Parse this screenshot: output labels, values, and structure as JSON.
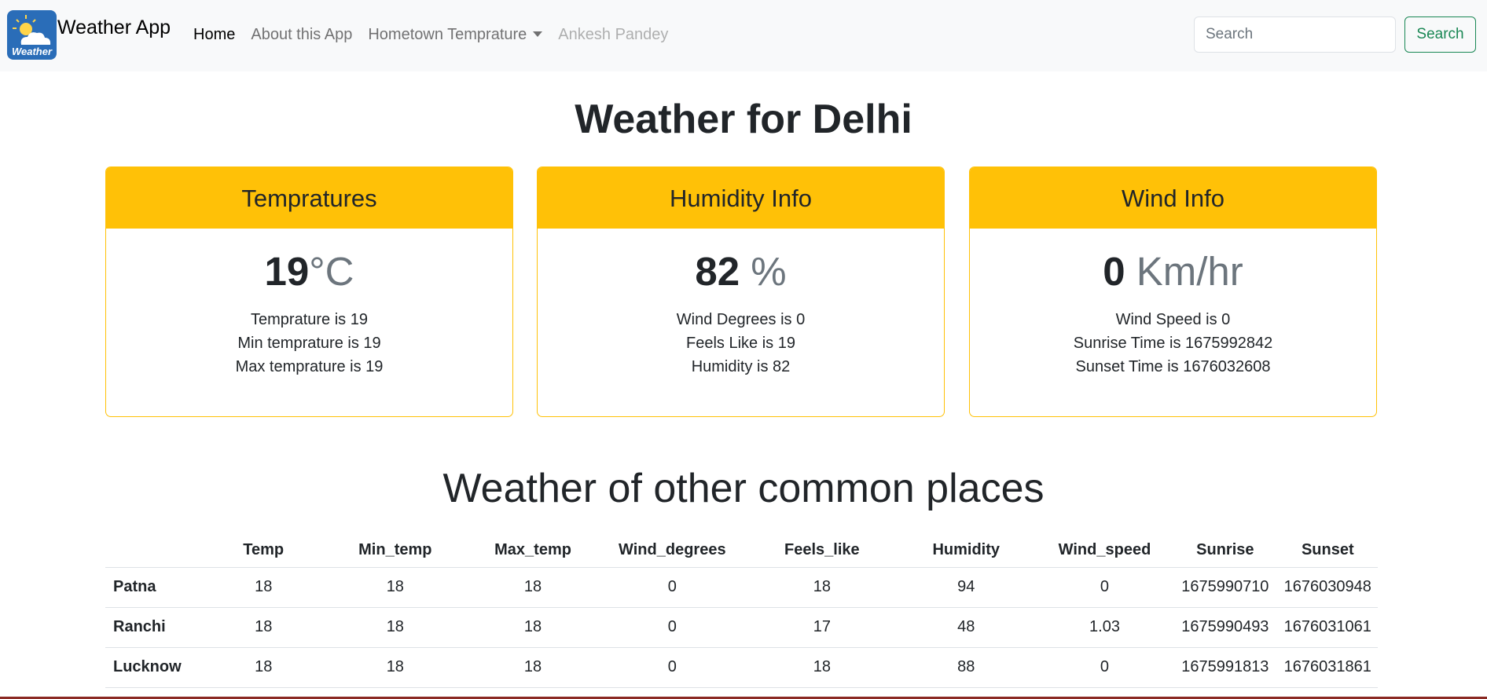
{
  "navbar": {
    "logo_text": "Weather",
    "brand": "Weather App",
    "links": [
      {
        "label": "Home"
      },
      {
        "label": "About this App"
      },
      {
        "label": "Hometown Temprature"
      },
      {
        "label": "Ankesh Pandey"
      }
    ],
    "search_placeholder": "Search",
    "search_button": "Search"
  },
  "page_title": "Weather for Delhi",
  "cards": [
    {
      "header": "Tempratures",
      "value": "19",
      "unit": "°C",
      "lines": [
        "Temprature is 19",
        "Min temprature is 19",
        "Max temprature is 19"
      ]
    },
    {
      "header": "Humidity Info",
      "value": "82",
      "unit": " %",
      "lines": [
        "Wind Degrees is 0",
        "Feels Like is 19",
        "Humidity is 82"
      ]
    },
    {
      "header": "Wind Info",
      "value": "0",
      "unit": " Km/hr",
      "lines": [
        "Wind Speed is 0",
        "Sunrise Time is 1675992842",
        "Sunset Time is 1676032608"
      ]
    }
  ],
  "section_title": "Weather of other common places",
  "table": {
    "columns": [
      "",
      "Temp",
      "Min_temp",
      "Max_temp",
      "Wind_degrees",
      "Feels_like",
      "Humidity",
      "Wind_speed",
      "Sunrise",
      "Sunset"
    ],
    "rows": [
      [
        "Patna",
        "18",
        "18",
        "18",
        "0",
        "18",
        "94",
        "0",
        "1675990710",
        "1676030948"
      ],
      [
        "Ranchi",
        "18",
        "18",
        "18",
        "0",
        "17",
        "48",
        "1.03",
        "1675990493",
        "1676031061"
      ],
      [
        "Lucknow",
        "18",
        "18",
        "18",
        "0",
        "18",
        "88",
        "0",
        "1675991813",
        "1676031861"
      ]
    ]
  },
  "colors": {
    "accent": "#ffc107",
    "success": "#198754",
    "navbar_bg": "#f8f9fa"
  }
}
